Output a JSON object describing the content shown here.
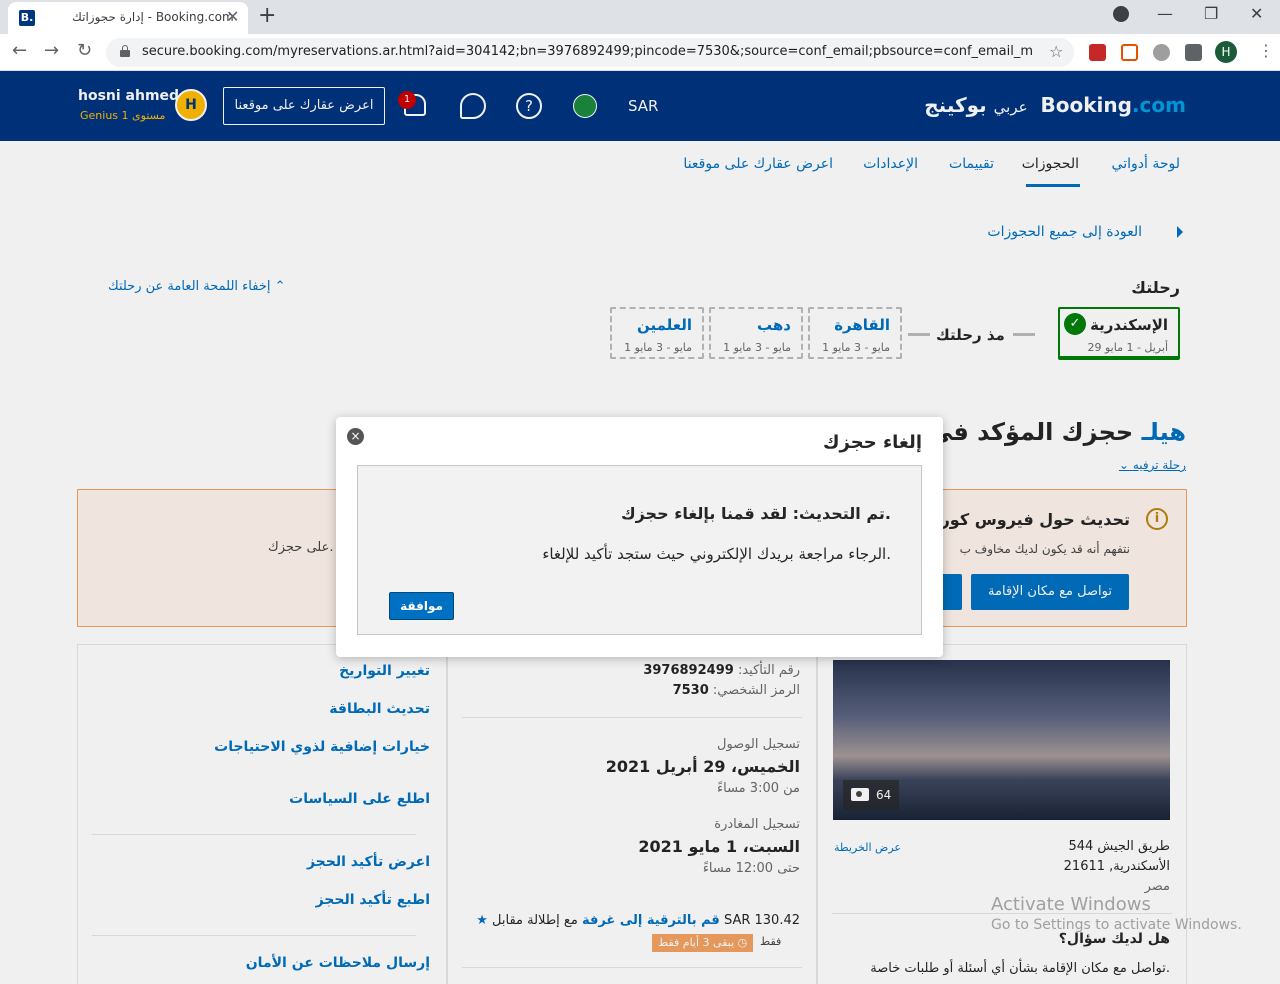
{
  "browser": {
    "tab_title": "إدارة حجوزاتك - Booking.com",
    "favicon_letter": "B.",
    "url": "secure.booking.com/myreservations.ar.html?aid=304142;bn=3976892499;pincode=7530&;source=conf_email;pbsource=conf_email_modify;pb...",
    "profile_initial": "H"
  },
  "header": {
    "logo_main": "Booking",
    "logo_com": ".com",
    "logo_arabic": "بوكينج",
    "language": "عربي",
    "currency": "SAR",
    "notification_count": "1",
    "list_property": "اعرض عقارك على موقعنا",
    "avatar_initial": "H",
    "username": "hosni ahmed",
    "genius_level": "Genius مستوى 1"
  },
  "subnav": {
    "items": [
      "لوحة أدواتي",
      "الحجوزات",
      "تقييمات",
      "الإعدادات",
      "اعرض عقارك على موقعنا"
    ]
  },
  "back_link": "العودة إلى جميع الحجوزات",
  "trip": {
    "title": "رحلتك",
    "hide_overview": "إخفاء اللمحة العامة عن رحلتك",
    "since_label": "مذ رحلتك",
    "cards": [
      {
        "city": "الإسكندرية",
        "dates": "29 أبريل - 1 مايو"
      },
      {
        "city": "القاهرة",
        "dates": "1 مايو - 3 مايو"
      },
      {
        "city": "دهب",
        "dates": "1 مايو - 3 مايو"
      },
      {
        "city": "العلمين",
        "dates": "1 مايو - 3 مايو"
      }
    ]
  },
  "booking": {
    "title_prefix": "حجزك المؤكد في",
    "hotel_partial": "هيلـ",
    "trip_type": "رحلة ترفيه"
  },
  "covid": {
    "title": "تحديث حول فيروس كورو",
    "text_right": "نتفهم أنه قد يكون لديك مخاوف ب",
    "text_left": "على حجزك.",
    "contact_button": "تواصل مع مكان الإقامة",
    "second_button": "ت"
  },
  "side_links": {
    "change_dates": "تغيير التواريخ",
    "update_card": "تحديث البطاقة",
    "accessibility": "خيارات إضافية لذوي الاحتياجات",
    "policies": "اطلع على السياسات",
    "show_confirmation": "اعرض تأكيد الحجز",
    "print_confirmation": "اطبع تأكيد الحجز",
    "safety_feedback": "إرسال ملاحظات عن الأمان"
  },
  "details": {
    "confirmation_label": "رقم التأكيد:",
    "confirmation_number": "3976892499",
    "pin_label": "الرمز الشخصي:",
    "pin": "7530",
    "checkin_label": "تسجيل الوصول",
    "checkin_date": "الخميس، 29 أبريل 2021",
    "checkin_time": "من 3:00 مساءً",
    "checkout_label": "تسجيل المغادرة",
    "checkout_date": "السبت، 1 مايو 2021",
    "checkout_time": "حتى 12:00 مساءً",
    "upgrade_link": "قم بالترقية إلى غرفة",
    "upgrade_rest": "مع إطلالة مقابل SAR 130.42",
    "days_left": "يبقى 3 أيام فقط",
    "only": "فقط"
  },
  "property": {
    "photo_count": "64",
    "address_line1": "544 طريق الجيش",
    "address_line2": "الأسكندرية, 21611",
    "address_line3": "مصر",
    "map_link": "عرض الخريطة",
    "question_title": "هل لديك سؤال؟",
    "question_text": "تواصل مع مكان الإقامة بشأن أي أسئلة أو طلبات خاصة."
  },
  "watermark": {
    "line1": "Activate Windows",
    "line2": "Go to Settings to activate Windows."
  },
  "dialog": {
    "title": "إلغاء حجزك",
    "heading": "تم التحديث: لقد قمنا بإلغاء حجزك.",
    "body": "الرجاء مراجعة بريدك الإلكتروني حيث ستجد تأكيد للإلغاء.",
    "ok_button": "موافقة"
  },
  "colors": {
    "brand_blue": "#003580",
    "link_blue": "#0071c2",
    "genius_yellow": "#febb02",
    "success_green": "#008009"
  }
}
